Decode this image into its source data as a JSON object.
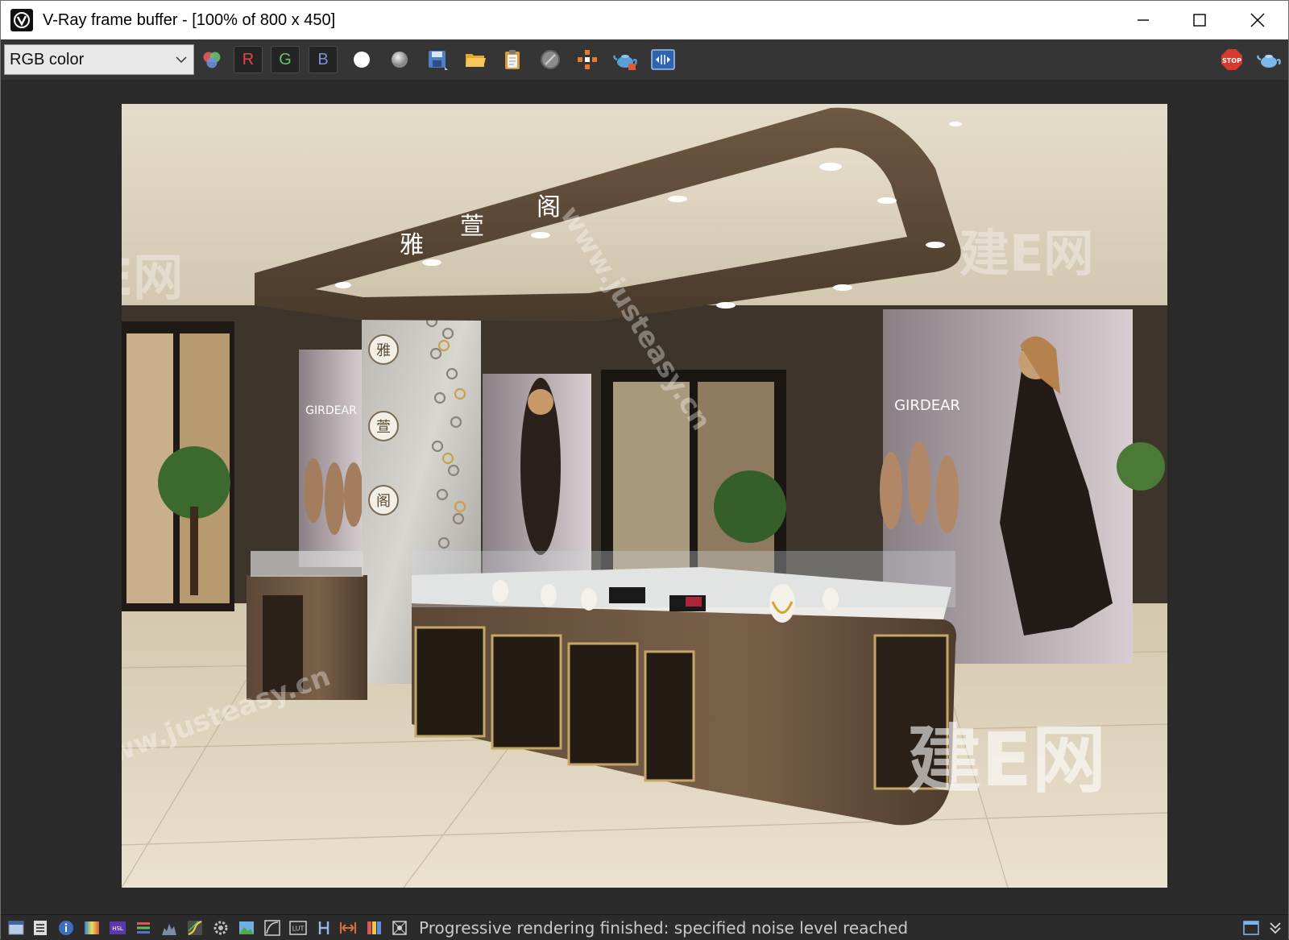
{
  "window": {
    "title": "V-Ray frame buffer - [100% of 800 x 450]"
  },
  "toolbar": {
    "channel": {
      "selected": "RGB color"
    },
    "red_label": "R",
    "green_label": "G",
    "blue_label": "B",
    "colors": {
      "red": "#e04848",
      "green": "#69c369",
      "blue": "#7c93d8"
    }
  },
  "render": {
    "signage": {
      "c1": "雅",
      "c2": "萱",
      "c3": "阁"
    },
    "poster_brand": "GIRDEAR",
    "watermarks": {
      "brand": "建E网",
      "url": "www.justeasy.cn"
    }
  },
  "status": {
    "message": "Progressive rendering finished: specified noise level reached"
  },
  "icons": [
    "app-logo-icon",
    "minimize-icon",
    "maximize-icon",
    "close-icon",
    "chevron-down-icon",
    "color-channels-icon",
    "white-dot-icon",
    "gray-dot-icon",
    "save-icon",
    "open-folder-icon",
    "clipboard-icon",
    "clear-icon",
    "region-render-icon",
    "teapot-icon",
    "compare-icon",
    "stop-icon",
    "teapot-render-icon"
  ]
}
